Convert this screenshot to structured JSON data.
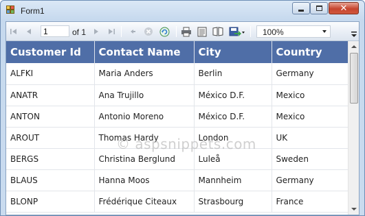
{
  "window": {
    "title": "Form1",
    "icon": "app-icon"
  },
  "caption_buttons": {
    "minimize": "minimize-icon",
    "maximize": "maximize-icon",
    "close": "close-icon"
  },
  "toolbar": {
    "current_page": "1",
    "of_label": "of 1",
    "zoom": "100%",
    "icons": [
      "first-page-icon",
      "previous-page-icon",
      "next-page-icon",
      "last-page-icon",
      "back-icon",
      "stop-icon",
      "refresh-icon",
      "print-icon",
      "print-layout-icon",
      "page-setup-icon",
      "export-icon",
      "zoom-dropdown-icon"
    ]
  },
  "report": {
    "columns": [
      "Customer Id",
      "Contact Name",
      "City",
      "Country"
    ],
    "rows": [
      [
        "ALFKI",
        "Maria Anders",
        "Berlin",
        "Germany"
      ],
      [
        "ANATR",
        "Ana Trujillo",
        "México D.F.",
        "Mexico"
      ],
      [
        "ANTON",
        "Antonio Moreno",
        "México D.F.",
        "Mexico"
      ],
      [
        "AROUT",
        "Thomas Hardy",
        "London",
        "UK"
      ],
      [
        "BERGS",
        "Christina Berglund",
        "Luleå",
        "Sweden"
      ],
      [
        "BLAUS",
        "Hanna Moos",
        "Mannheim",
        "Germany"
      ],
      [
        "BLONP",
        "Frédérique Citeaux",
        "Strasbourg",
        "France"
      ]
    ],
    "header_color": "#4F6EA7",
    "watermark": "© aspsnippets.com"
  }
}
